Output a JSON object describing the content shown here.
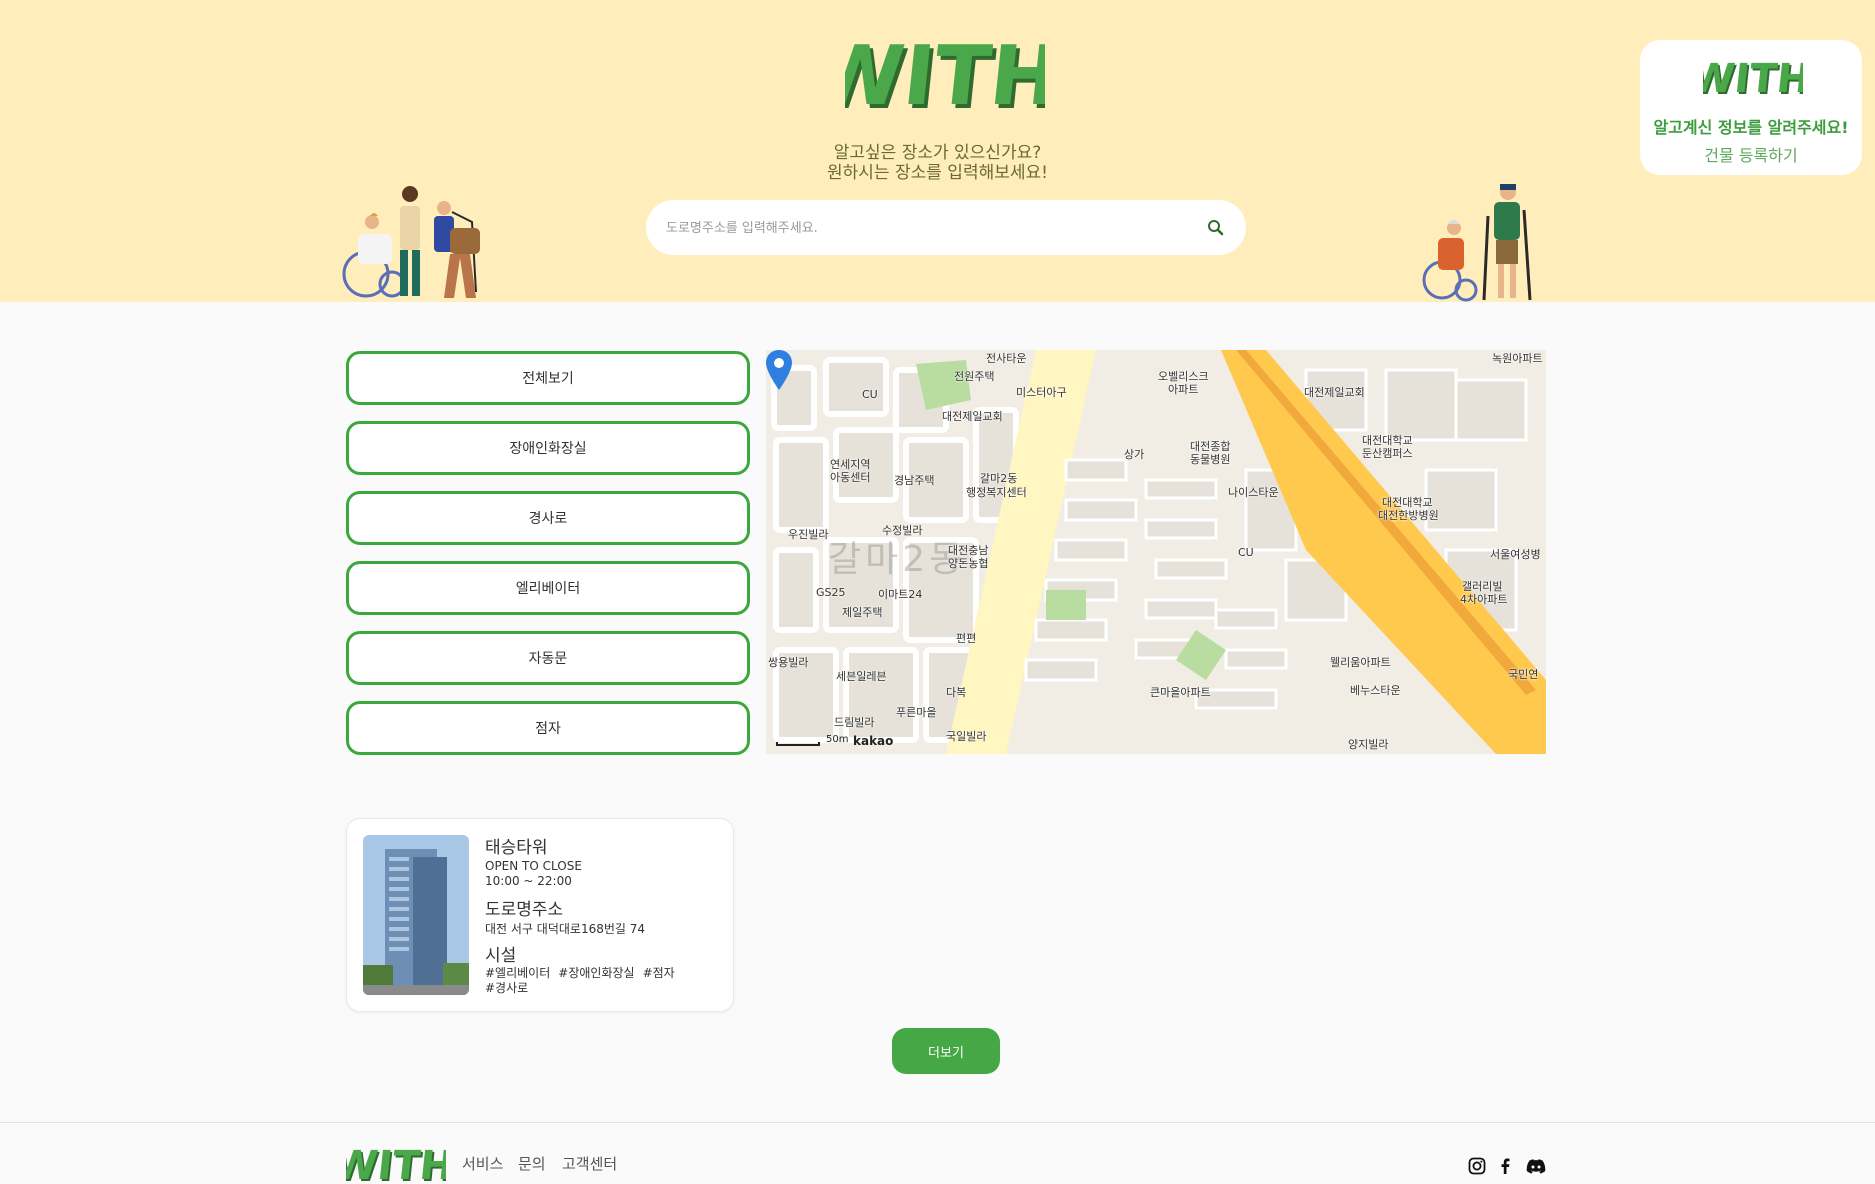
{
  "brand": {
    "logo_text": "WITH",
    "green": "#3e9a3e",
    "green_dark": "#2f6b2f",
    "hero_bg": "#ffeebc"
  },
  "hero": {
    "subtitle_line1": "알고싶은 장소가 있으신가요?",
    "subtitle_line2": "원하시는 장소를 입력해보세요!",
    "search_placeholder": "도로명주소를 입력해주세요.",
    "search_icon": "search-icon"
  },
  "promo": {
    "logo_text": "WITH",
    "text": "알고계신 정보를 알려주세요!",
    "link_label": "건물 등록하기"
  },
  "filters": [
    "전체보기",
    "장애인화장실",
    "경사로",
    "엘리베이터",
    "자동문",
    "점자"
  ],
  "map": {
    "watermark": "갈마2동",
    "scale_label": "50m",
    "provider": "kakao",
    "labels": [
      {
        "t": "전사타운"
      },
      {
        "t": "전원주택"
      },
      {
        "t": "미스터아구"
      },
      {
        "t": "대전제일교회"
      },
      {
        "t": "CU"
      },
      {
        "t": "연세지역"
      },
      {
        "t": "아동센터"
      },
      {
        "t": "경남주택"
      },
      {
        "t": "갈마2동"
      },
      {
        "t": "행정복지센터"
      },
      {
        "t": "우진빌라"
      },
      {
        "t": "수정빌라"
      },
      {
        "t": "대전충남"
      },
      {
        "t": "양돈농협"
      },
      {
        "t": "GS25"
      },
      {
        "t": "이마트24"
      },
      {
        "t": "제일주택"
      },
      {
        "t": "편편"
      },
      {
        "t": "쌍용빌라"
      },
      {
        "t": "세븐일레븐"
      },
      {
        "t": "다복"
      },
      {
        "t": "푸른마을"
      },
      {
        "t": "드림빌라"
      },
      {
        "t": "국일빌라"
      },
      {
        "t": "오벨리스크"
      },
      {
        "t": "아파트"
      },
      {
        "t": "상가"
      },
      {
        "t": "대전종합"
      },
      {
        "t": "동물병원"
      },
      {
        "t": "나이스타운"
      },
      {
        "t": "CU"
      },
      {
        "t": "대전제일교회"
      },
      {
        "t": "대전대학교"
      },
      {
        "t": "둔산캠퍼스"
      },
      {
        "t": "대전대학교"
      },
      {
        "t": "대전한방병원"
      },
      {
        "t": "녹원아파트"
      },
      {
        "t": "서울여성병"
      },
      {
        "t": "갤러리빌"
      },
      {
        "t": "4차아파트"
      },
      {
        "t": "웰리움아파트"
      },
      {
        "t": "베누스타운"
      },
      {
        "t": "큰마을아파트"
      },
      {
        "t": "양지빌라"
      },
      {
        "t": "국민연"
      }
    ]
  },
  "place": {
    "name": "태승타워",
    "hours_label": "OPEN TO CLOSE",
    "hours": "10:00 ~ 22:00",
    "address_label": "도로명주소",
    "address": "대전 서구 대덕대로168번길 74",
    "facilities_label": "시설",
    "tags": [
      "#엘리베이터",
      "#장애인화장실",
      "#점자",
      "#경사로"
    ]
  },
  "more_label": "더보기",
  "footer": {
    "logo_text": "WITH",
    "nav": [
      "서비스",
      "문의",
      "고객센터"
    ],
    "social": [
      "instagram-icon",
      "facebook-icon",
      "discord-icon"
    ]
  }
}
